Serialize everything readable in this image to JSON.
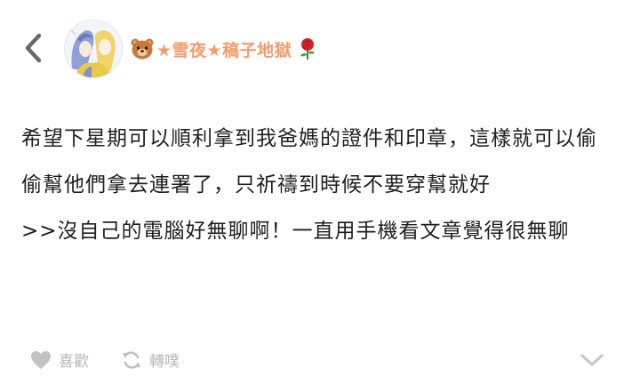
{
  "post": {
    "author": {
      "emoji_left": "bear-face-emoji",
      "name": "★雪夜★稿子地獄",
      "emoji_right": "rose-emoji"
    },
    "paragraphs": [
      "希望下星期可以順利拿到我爸媽的證件和印章，這樣就可以偷偷幫他們拿去連署了，只祈禱到時候不要穿幫就好",
      ">>沒自己的電腦好無聊啊！一直用手機看文章覺得很無聊"
    ]
  },
  "actions": {
    "like_label": "喜歡",
    "repost_label": "轉噗"
  },
  "icons": {
    "back": "chevron-left-icon",
    "like": "heart-icon",
    "repost": "repost-icon",
    "expand": "chevron-down-icon"
  },
  "colors": {
    "author_name": "#f39c6b",
    "action_gray": "#b8b8b8",
    "text": "#1f1f1f"
  }
}
